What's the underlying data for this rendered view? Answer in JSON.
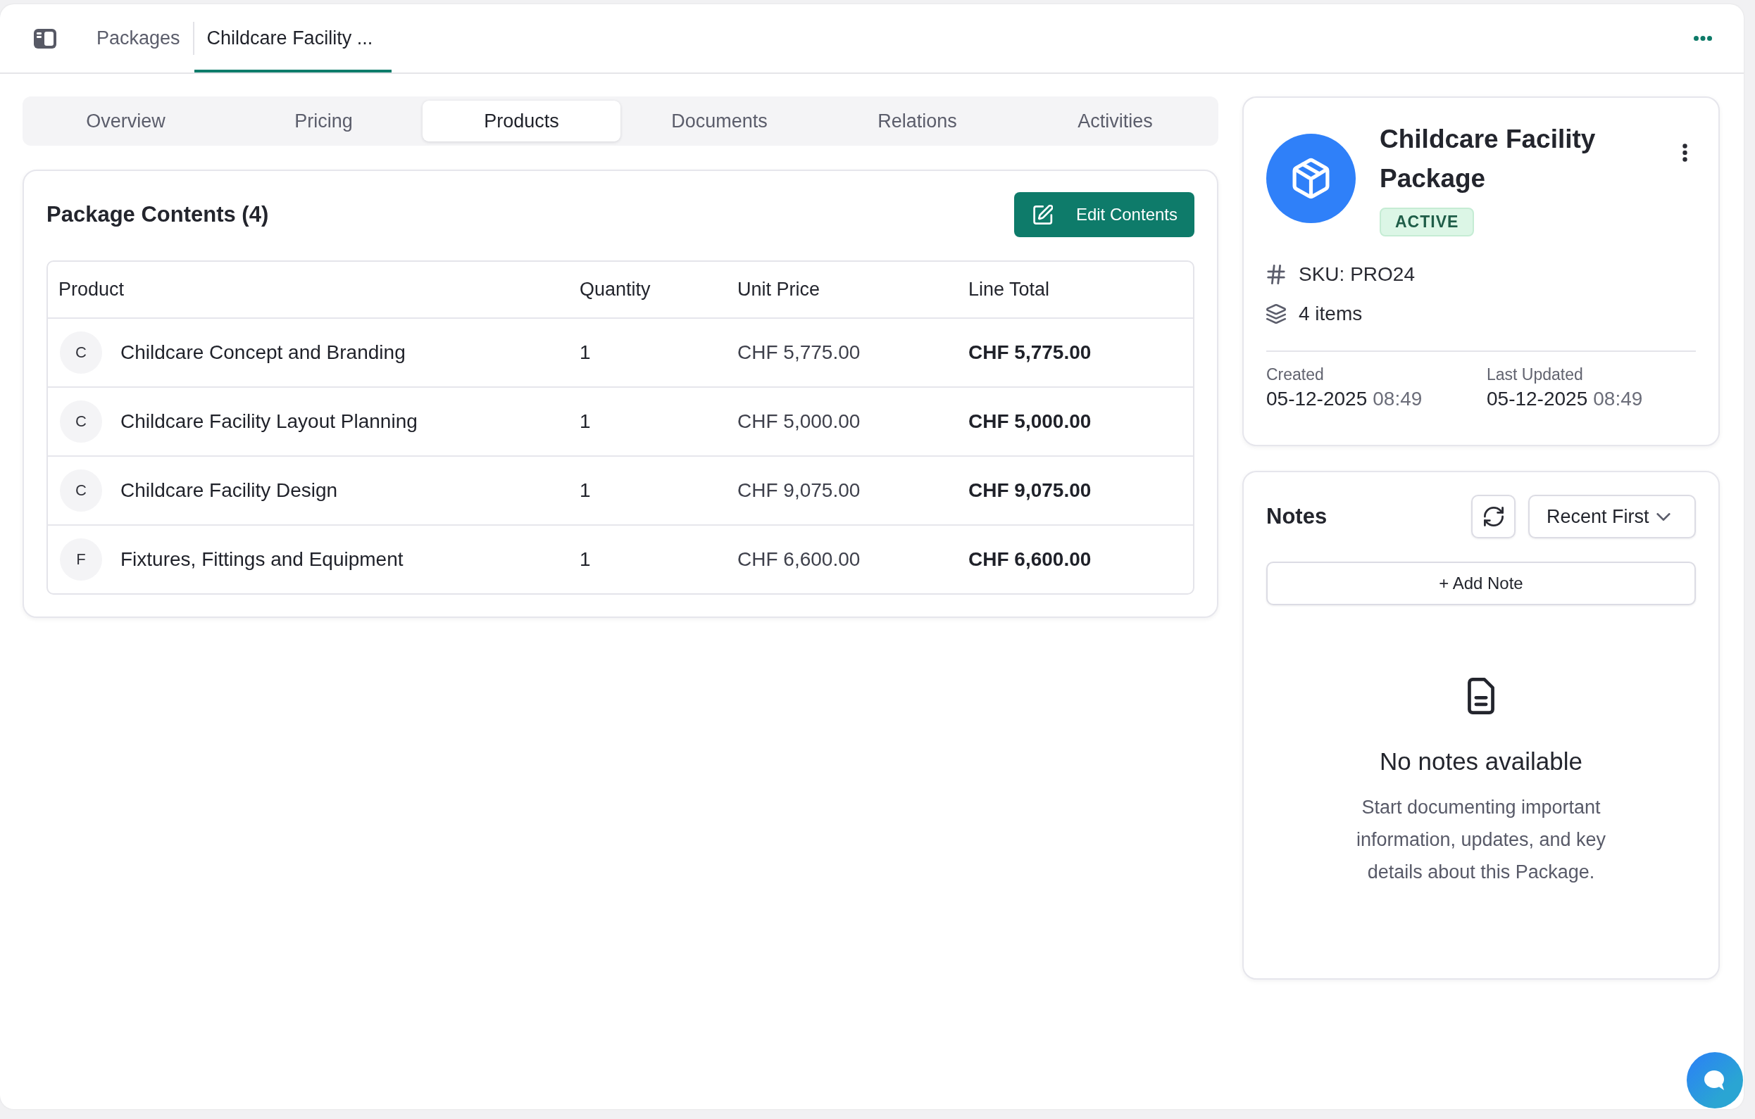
{
  "breadcrumbs": [
    {
      "label": "Packages",
      "selected": false
    },
    {
      "label": "Childcare Facility ...",
      "selected": true
    }
  ],
  "tabs": [
    {
      "label": "Overview",
      "selected": false
    },
    {
      "label": "Pricing",
      "selected": false
    },
    {
      "label": "Products",
      "selected": true
    },
    {
      "label": "Documents",
      "selected": false
    },
    {
      "label": "Relations",
      "selected": false
    },
    {
      "label": "Activities",
      "selected": false
    }
  ],
  "contents": {
    "title": "Package Contents (4)",
    "edit_button": "Edit Contents",
    "table": {
      "columns": [
        "Product",
        "Quantity",
        "Unit Price",
        "Line Total"
      ],
      "rows": [
        {
          "initial": "C",
          "product": "Childcare Concept and Branding",
          "quantity": "1",
          "unit_price": "CHF 5,775.00",
          "line_total": "CHF 5,775.00"
        },
        {
          "initial": "C",
          "product": "Childcare Facility Layout Planning",
          "quantity": "1",
          "unit_price": "CHF 5,000.00",
          "line_total": "CHF 5,000.00"
        },
        {
          "initial": "C",
          "product": "Childcare Facility Design",
          "quantity": "1",
          "unit_price": "CHF 9,075.00",
          "line_total": "CHF 9,075.00"
        },
        {
          "initial": "F",
          "product": "Fixtures, Fittings and Equipment",
          "quantity": "1",
          "unit_price": "CHF 6,600.00",
          "line_total": "CHF 6,600.00"
        }
      ]
    }
  },
  "package": {
    "title": "Childcare Facility Package",
    "status": "ACTIVE",
    "sku": "SKU: PRO24",
    "item_count": "4 items",
    "dates": [
      {
        "label": "Created",
        "date": "05-12-2025",
        "time": "08:49"
      },
      {
        "label": "Last Updated",
        "date": "05-12-2025",
        "time": "08:49"
      }
    ]
  },
  "notes": {
    "title": "Notes",
    "sort": "Recent First",
    "add_button": "+ Add Note",
    "empty": {
      "title": "No notes available",
      "text": "Start documenting important information, updates, and key details about this Package."
    }
  }
}
